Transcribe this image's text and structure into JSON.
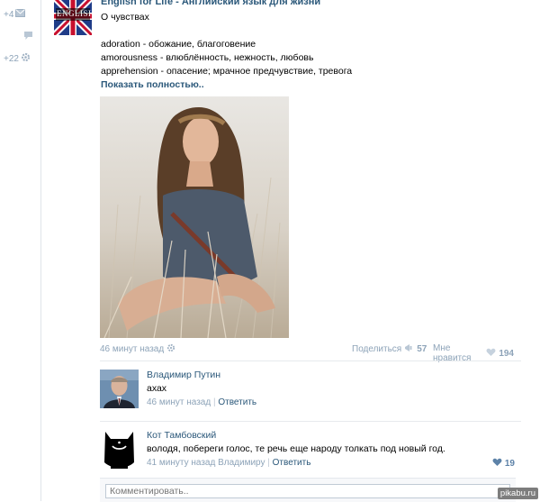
{
  "sidebar": {
    "counter1": "+4",
    "counter3": "+22"
  },
  "post": {
    "author": "English for Life - Английский язык для жизни",
    "avatar_text": "ENGLISH",
    "title": "О чувствах",
    "lines": [
      "adoration - обожание, благоговение",
      "amorousness - влюблённость, нежность, любовь",
      "apprehension - опасение; мрачное предчувствие, тревога"
    ],
    "show_more": "Показать полностью..",
    "time": "46 минут назад",
    "share_label": "Поделиться",
    "share_count": "57",
    "like_label": "Мне нравится",
    "like_count": "194"
  },
  "comments": [
    {
      "name": "Владимир Путин",
      "text": "ахах",
      "time": "46 минут назад",
      "reply": "Ответить"
    },
    {
      "name": "Кот Тамбовский",
      "text": "володя, побереги голос, те речь еще народу толкать под новый год.",
      "time": "41 минуту назад Владимиру",
      "reply": "Ответить",
      "likes": "19"
    }
  ],
  "reply_box": {
    "placeholder": "Комментировать.."
  },
  "watermark": "pikabu.ru",
  "colors": {
    "link": "#2b587a",
    "meta": "#8da3b8"
  }
}
